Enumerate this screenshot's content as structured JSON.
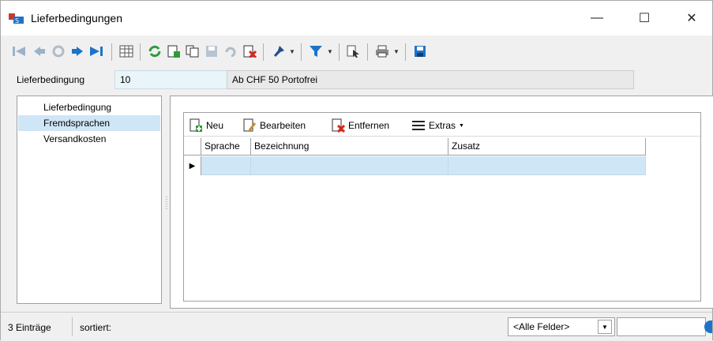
{
  "window": {
    "title": "Lieferbedingungen",
    "controls": {
      "minimize": "—",
      "maximize": "☐",
      "close": "✕"
    }
  },
  "toolbar": {
    "icons": [
      "first-record-icon",
      "previous-record-icon",
      "refresh-disabled-icon",
      "next-record-icon",
      "last-record-icon",
      "table-view-icon",
      "reload-icon",
      "new-record-icon",
      "copy-record-icon",
      "save-record-icon",
      "undo-icon",
      "delete-record-icon",
      "pin-icon",
      "filter-icon",
      "pointer-select-icon",
      "print-icon",
      "save-disk-icon"
    ]
  },
  "header": {
    "label": "Lieferbedingung",
    "code": "10",
    "description": "Ab CHF 50 Portofrei"
  },
  "nav": {
    "items": [
      {
        "label": "Lieferbedingung",
        "selected": false
      },
      {
        "label": "Fremdsprachen",
        "selected": true
      },
      {
        "label": "Versandkosten",
        "selected": false
      }
    ]
  },
  "grid": {
    "toolbar": {
      "new_label": "Neu",
      "edit_label": "Bearbeiten",
      "delete_label": "Entfernen",
      "extras_label": "Extras"
    },
    "columns": [
      "Sprache",
      "Bezeichnung",
      "Zusatz"
    ],
    "rows": [
      {
        "Sprache": "",
        "Bezeichnung": "",
        "Zusatz": ""
      }
    ]
  },
  "status": {
    "count": "3 Einträge",
    "sort": "sortiert:",
    "field_filter": "<Alle Felder>"
  },
  "colors": {
    "selection": "#cfe6f7",
    "accent_blue": "#1e73c9",
    "delete_red": "#d9261c",
    "new_green": "#2e9b3a"
  }
}
